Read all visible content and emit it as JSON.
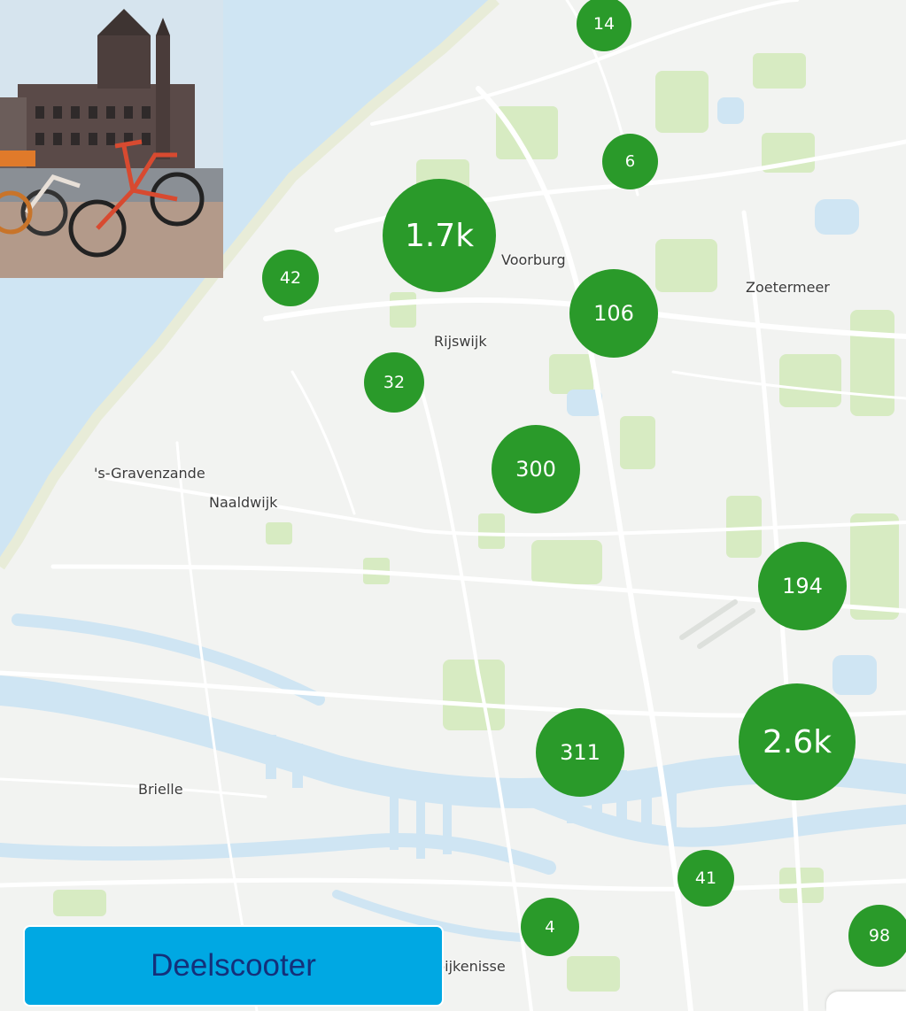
{
  "map": {
    "places": [
      {
        "id": "voorburg",
        "name": "Voorburg"
      },
      {
        "id": "zoetermeer",
        "name": "Zoetermeer"
      },
      {
        "id": "rijswijk",
        "name": "Rijswijk"
      },
      {
        "id": "s-gravenzande",
        "name": "'s-Gravenzande"
      },
      {
        "id": "naaldwijk",
        "name": "Naaldwijk"
      },
      {
        "id": "brielle",
        "name": "Brielle"
      },
      {
        "id": "spijkenisse",
        "name": "pijkenisse"
      }
    ],
    "clusters": [
      {
        "id": "c14",
        "label": "14",
        "count": 14
      },
      {
        "id": "c6",
        "label": "6",
        "count": 6
      },
      {
        "id": "c1_7k",
        "label": "1.7k",
        "count": 1700
      },
      {
        "id": "c42",
        "label": "42",
        "count": 42
      },
      {
        "id": "c106",
        "label": "106",
        "count": 106
      },
      {
        "id": "c32",
        "label": "32",
        "count": 32
      },
      {
        "id": "c300",
        "label": "300",
        "count": 300
      },
      {
        "id": "c194",
        "label": "194",
        "count": 194
      },
      {
        "id": "c311",
        "label": "311",
        "count": 311
      },
      {
        "id": "c2_6k",
        "label": "2.6k",
        "count": 2600
      },
      {
        "id": "c41",
        "label": "41",
        "count": 41
      },
      {
        "id": "c4",
        "label": "4",
        "count": 4
      },
      {
        "id": "c98",
        "label": "98",
        "count": 98
      }
    ],
    "colors": {
      "cluster": "#2a9a2a",
      "water": "#cfe5f3",
      "land": "#f2f3f1",
      "green": "#d7ebc2"
    }
  },
  "overlay": {
    "photo": {
      "subject": "shared-bicycles-in-front-of-binnenhof"
    },
    "label": "Deelscooter",
    "label_colors": {
      "background": "#00a8e3",
      "text": "#14307a"
    }
  }
}
